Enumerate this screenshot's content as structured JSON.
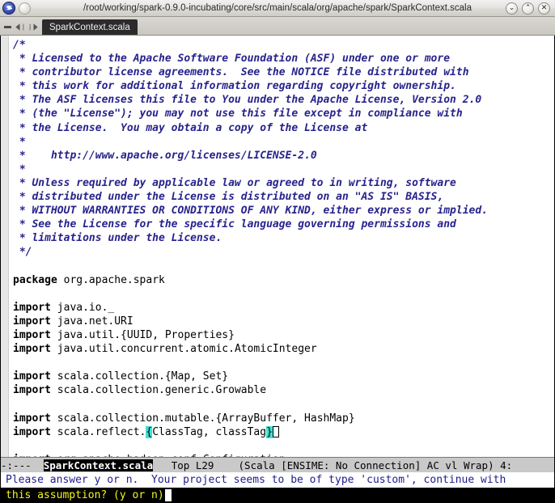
{
  "window": {
    "title": "/root/working/spark-0.9.0-incubating/core/src/main/scala/org/apache/spark/SparkContext.scala",
    "logo_icon": "emacs-logo-icon",
    "orb_icon": "window-orb-icon",
    "buttons": [
      {
        "name": "minimize-button",
        "icon": "chevron-down-icon",
        "glyph": "⌄"
      },
      {
        "name": "maximize-button",
        "icon": "chevron-up-icon",
        "glyph": "⌃"
      },
      {
        "name": "close-button",
        "icon": "close-x-icon",
        "glyph": "✕"
      }
    ]
  },
  "tabbar": {
    "minus_icon": "minus-icon",
    "prev_icon": "arrow-left-icon",
    "next_icon": "arrow-right-icon",
    "tabs": [
      {
        "label": "SparkContext.scala",
        "active": true
      }
    ]
  },
  "editor": {
    "lines": [
      [
        {
          "t": "/*",
          "c": "cmt"
        }
      ],
      [
        {
          "t": " * Licensed to the Apache Software Foundation (ASF) under one or more",
          "c": "cmt"
        }
      ],
      [
        {
          "t": " * contributor license agreements.  See the NOTICE file distributed with",
          "c": "cmt"
        }
      ],
      [
        {
          "t": " * this work for additional information regarding copyright ownership.",
          "c": "cmt"
        }
      ],
      [
        {
          "t": " * The ASF licenses this file to You under the Apache License, Version 2.0",
          "c": "cmt"
        }
      ],
      [
        {
          "t": " * (the \"License\"); you may not use this file except in compliance with",
          "c": "cmt"
        }
      ],
      [
        {
          "t": " * the License.  You may obtain a copy of the License at",
          "c": "cmt"
        }
      ],
      [
        {
          "t": " *",
          "c": "cmt"
        }
      ],
      [
        {
          "t": " *    http://www.apache.org/licenses/LICENSE-2.0",
          "c": "cmt"
        }
      ],
      [
        {
          "t": " *",
          "c": "cmt"
        }
      ],
      [
        {
          "t": " * Unless required by applicable law or agreed to in writing, software",
          "c": "cmt"
        }
      ],
      [
        {
          "t": " * distributed under the License is distributed on an \"AS IS\" BASIS,",
          "c": "cmt"
        }
      ],
      [
        {
          "t": " * WITHOUT WARRANTIES OR CONDITIONS OF ANY KIND, either express or implied.",
          "c": "cmt"
        }
      ],
      [
        {
          "t": " * See the License for the specific language governing permissions and",
          "c": "cmt"
        }
      ],
      [
        {
          "t": " * limitations under the License.",
          "c": "cmt"
        }
      ],
      [
        {
          "t": " */",
          "c": "cmt"
        }
      ],
      [
        {
          "t": "",
          "c": ""
        }
      ],
      [
        {
          "t": "package",
          "c": "kw"
        },
        {
          "t": " org.apache.spark",
          "c": ""
        }
      ],
      [
        {
          "t": "",
          "c": ""
        }
      ],
      [
        {
          "t": "import",
          "c": "kw"
        },
        {
          "t": " java.io._",
          "c": ""
        }
      ],
      [
        {
          "t": "import",
          "c": "kw"
        },
        {
          "t": " java.net.URI",
          "c": ""
        }
      ],
      [
        {
          "t": "import",
          "c": "kw"
        },
        {
          "t": " java.util.{UUID, Properties}",
          "c": ""
        }
      ],
      [
        {
          "t": "import",
          "c": "kw"
        },
        {
          "t": " java.util.concurrent.atomic.AtomicInteger",
          "c": ""
        }
      ],
      [
        {
          "t": "",
          "c": ""
        }
      ],
      [
        {
          "t": "import",
          "c": "kw"
        },
        {
          "t": " scala.collection.{Map, Set}",
          "c": ""
        }
      ],
      [
        {
          "t": "import",
          "c": "kw"
        },
        {
          "t": " scala.collection.generic.Growable",
          "c": ""
        }
      ],
      [
        {
          "t": "",
          "c": ""
        }
      ],
      [
        {
          "t": "import",
          "c": "kw"
        },
        {
          "t": " scala.collection.mutable.{ArrayBuffer, HashMap}",
          "c": ""
        }
      ],
      [
        {
          "t": "import",
          "c": "kw"
        },
        {
          "t": " scala.reflect.",
          "c": ""
        },
        {
          "t": "{",
          "c": "hl-paren"
        },
        {
          "t": "ClassTag, classTag",
          "c": ""
        },
        {
          "t": "}",
          "c": "hl-paren"
        },
        {
          "t": "",
          "c": "cursor"
        }
      ],
      [
        {
          "t": "",
          "c": ""
        }
      ],
      [
        {
          "t": "import",
          "c": "kw"
        },
        {
          "t": " org.apache.hadoop.conf.Configuration",
          "c": ""
        }
      ]
    ]
  },
  "modeline": {
    "left": "-:---  ",
    "buffer_name": "SparkContext.scala",
    "position": "   Top L29    ",
    "modes": "(Scala [ENSIME: No Connection] AC vl Wrap) 4:"
  },
  "minibuffer": {
    "line1": "Please answer y or n.  Your project seems to be of type 'custom', continue with",
    "line2": "this assumption? (y or n)"
  },
  "colors": {
    "comment": "#27238c",
    "keyword": "#000000",
    "paren_match_bg": "#40e0d0",
    "minibuffer_prompt": "#f5f51e",
    "minibuffer_message": "#1c1c8f",
    "modeline_bg": "#c9c9c9",
    "tab_active_bg": "#2b2b2b"
  }
}
